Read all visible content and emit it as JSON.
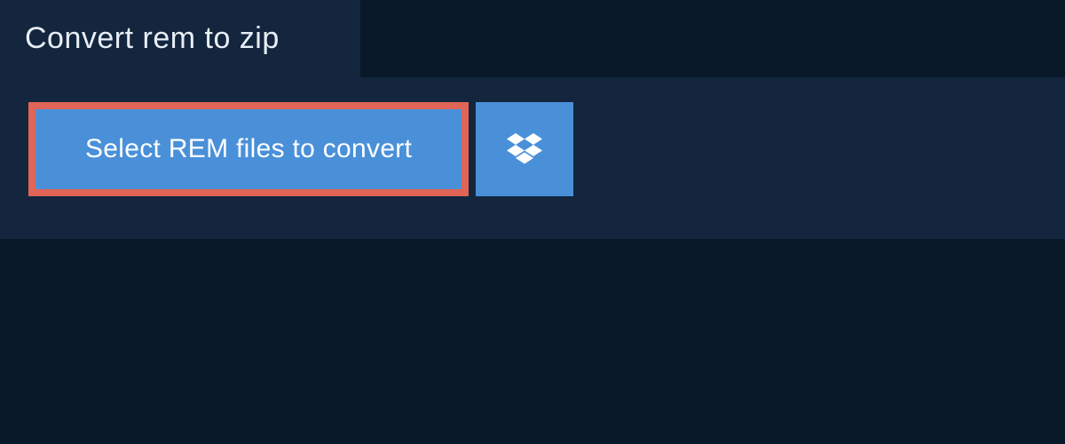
{
  "header": {
    "title": "Convert rem to zip"
  },
  "actions": {
    "select_label": "Select REM files to convert"
  },
  "colors": {
    "highlight_border": "#e06556",
    "button_bg": "#4a90d9",
    "panel_bg": "#13263e",
    "page_bg": "#0a1929"
  }
}
